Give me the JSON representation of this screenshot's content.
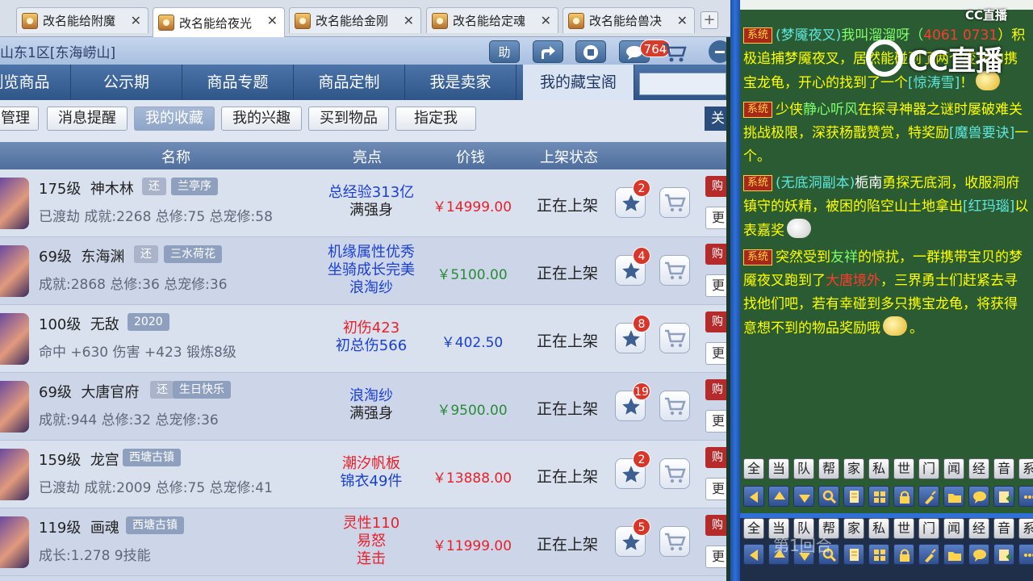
{
  "tabs": [
    {
      "label": "改名能给附魔"
    },
    {
      "label": "改名能给夜光"
    },
    {
      "label": "改名能给金刚"
    },
    {
      "label": "改名能给定魂"
    },
    {
      "label": "改名能给兽决"
    }
  ],
  "tab_close": "✕",
  "new_tab": "+",
  "game": {
    "breadcrumb": "山东1区[东海崂山]",
    "toolbar": {
      "help": "助",
      "notify_count": "764"
    },
    "nav": [
      "浏览商品",
      "公示期",
      "商品专题",
      "商品定制",
      "我是卖家",
      "我的藏宝阁"
    ],
    "subnav": [
      "管理",
      "消息提醒",
      "我的收藏",
      "我的兴趣",
      "买到物品",
      "指定我"
    ],
    "subnav_right": "关",
    "columns": {
      "name": "名称",
      "highlight": "亮点",
      "price": "价钱",
      "status": "上架状态"
    },
    "rows": [
      {
        "level": "175级",
        "name": "神木林",
        "huan": "还",
        "tag": "兰亭序",
        "desc": "已渡劫 成就:2268 总修:75 总宠修:58",
        "hl1": "总经验313亿",
        "hl2": "满强身",
        "hl3": "",
        "price": "￥14999.00",
        "status": "正在上架",
        "fav": "2",
        "b1": "购",
        "b2": "更"
      },
      {
        "level": "69级",
        "name": "东海渊",
        "huan": "还",
        "tag": "三水荷花",
        "desc": "成就:2868 总修:36 总宠修:36",
        "hl1": "机缘属性优秀",
        "hl2": "坐骑成长完美",
        "hl3": "浪淘纱",
        "price": "￥5100.00",
        "status": "正在上架",
        "fav": "4",
        "b1": "购",
        "b2": "更"
      },
      {
        "level": "100级",
        "name": "无敌",
        "huan": "",
        "tag": "2020",
        "desc": "命中 +630 伤害 +423 锻炼8级",
        "hl1": "初伤423",
        "hl2": "初总伤566",
        "hl3": "",
        "price": "￥402.50",
        "status": "正在上架",
        "fav": "8",
        "b1": "购",
        "b2": "更"
      },
      {
        "level": "69级",
        "name": "大唐官府",
        "huan": "还",
        "tag": "生日快乐",
        "desc": "成就:944 总修:32 总宠修:36",
        "hl1": "浪淘纱",
        "hl2": "满强身",
        "hl3": "",
        "price": "￥9500.00",
        "status": "正在上架",
        "fav": "19",
        "b1": "购",
        "b2": "更"
      },
      {
        "level": "159级",
        "name": "龙宫",
        "huan": "",
        "tag": "西塘古镇",
        "desc": "已渡劫 成就:2009 总修:75 总宠修:41",
        "hl1": "潮汐帆板",
        "hl2": "锦衣49件",
        "hl3": "",
        "price": "￥13888.00",
        "status": "正在上架",
        "fav": "2",
        "b1": "购",
        "b2": "更"
      },
      {
        "level": "119级",
        "name": "画魂",
        "huan": "",
        "tag": "西塘古镇",
        "desc": "成长:1.278 9技能",
        "hl1": "灵性110",
        "hl2": "易怒",
        "hl3": "连击",
        "price": "￥11999.00",
        "status": "正在上架",
        "fav": "5",
        "b1": "购",
        "b2": "更"
      }
    ]
  },
  "chat": {
    "watermark": "CC直播",
    "logo_small": "CC直播",
    "sys_label": "系统",
    "messages": [
      {
        "p1": "(梦魇夜叉)",
        "p2": "我叫溜溜呀（",
        "p3": "4061 0731",
        "p4": "）积极追捕梦魇夜叉，居然能碰到了两个变异的携宝龙龟，开心的找到了一个",
        "p5": "[惊涛雪]",
        "p6": "！"
      },
      {
        "p1": "少侠",
        "p2": "静心听风",
        "p3": "在探寻神器之谜时屡破难关挑战极限，深获杨戬赞赏，特奖励",
        "p4": "[魔兽要诀]",
        "p5": "一个。"
      },
      {
        "p1": "(无底洞副本)",
        "p2": "栀南",
        "p3": "勇探无底洞，收服洞府镇守的妖精，被困的陷空山土地拿出",
        "p4": "[红玛瑙]",
        "p5": "以表嘉奖"
      },
      {
        "p1": "突然受到",
        "p2": "友祥",
        "p3": "的惊扰，一群携带宝贝的梦魇夜叉跑到了",
        "p4": "大唐境外",
        "p5": "，三界勇士们赶紧去寻找他们吧，若有幸碰到多只携宝龙龟，将获得意想不到的物品奖励哦",
        "p6": "。"
      }
    ],
    "channels": [
      "全",
      "当",
      "队",
      "帮",
      "家",
      "私",
      "世",
      "门",
      "闻",
      "经",
      "音",
      "系"
    ],
    "overlay": "第1回合"
  },
  "colors": {
    "price_red": "#e8202a",
    "price_green": "#2a8a3a",
    "price_blue": "#1a3fd0",
    "hl_blue": "#1a3fd0",
    "hl_red": "#e8202a"
  }
}
